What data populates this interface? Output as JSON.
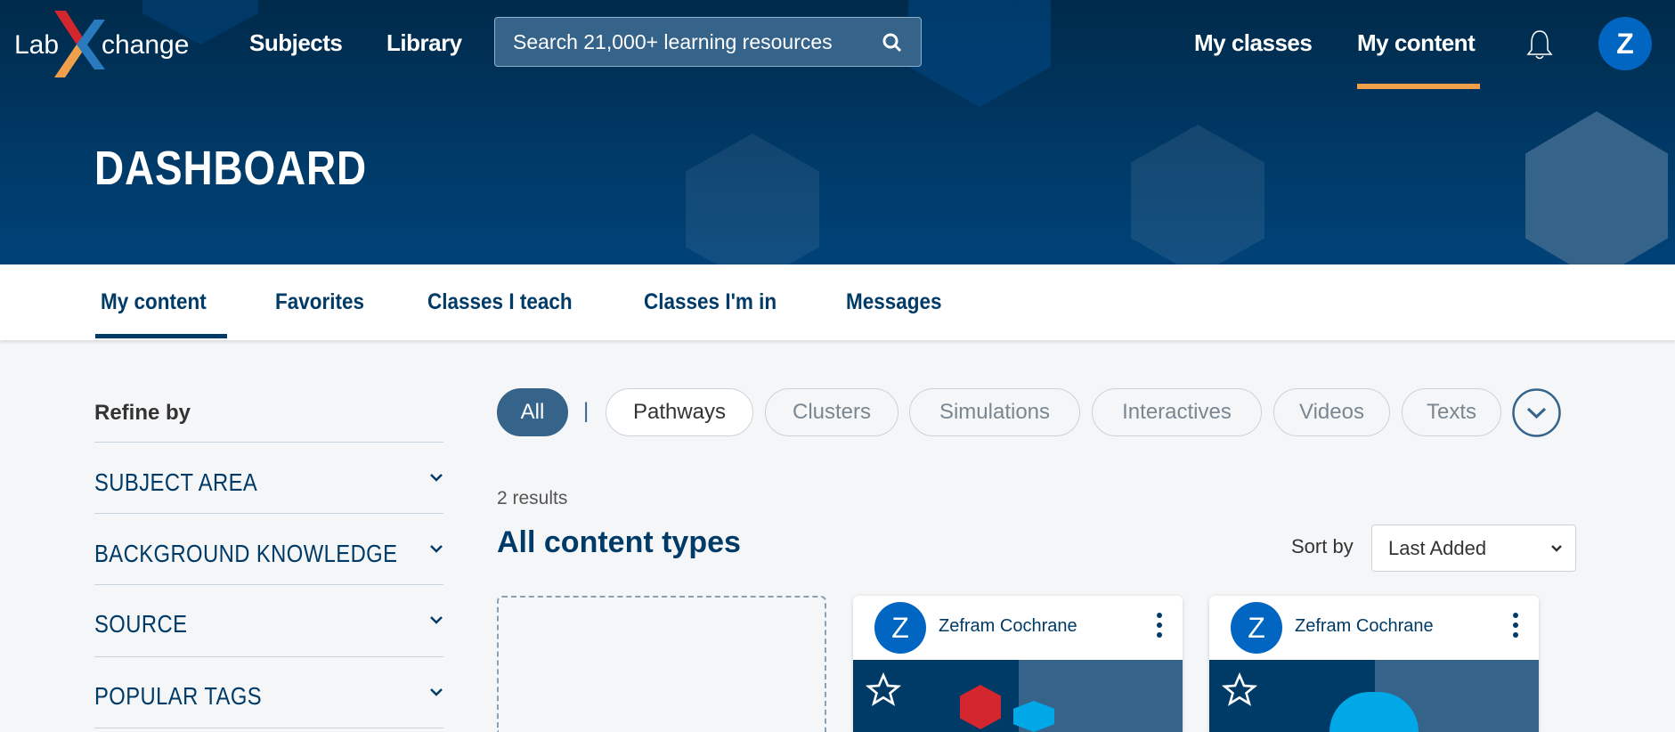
{
  "header": {
    "logo_text": "LabXchange",
    "nav": [
      "Subjects",
      "Library"
    ],
    "search_placeholder": "Search 21,000+ learning resources",
    "right_nav": [
      "My classes",
      "My content"
    ],
    "avatar_initial": "Z"
  },
  "hero": {
    "title": "DASHBOARD"
  },
  "tabs": [
    "My content",
    "Favorites",
    "Classes I teach",
    "Classes I'm in",
    "Messages"
  ],
  "sidebar": {
    "heading": "Refine by",
    "facets": [
      "SUBJECT AREA",
      "BACKGROUND KNOWLEDGE",
      "SOURCE",
      "POPULAR TAGS"
    ]
  },
  "filters": {
    "chips": [
      "All",
      "Pathways",
      "Clusters",
      "Simulations",
      "Interactives",
      "Videos",
      "Texts"
    ],
    "separator": "|"
  },
  "results": {
    "count": "2 results",
    "heading": "All content types",
    "sort_label": "Sort by",
    "sort_value": "Last Added"
  },
  "cards": [
    {
      "initial": "Z",
      "author": "Zefram Cochrane"
    },
    {
      "initial": "Z",
      "author": "Zefram Cochrane"
    }
  ],
  "colors": {
    "accent": "#f0a04b",
    "primary": "#003a66",
    "avatar": "#0066c2"
  }
}
